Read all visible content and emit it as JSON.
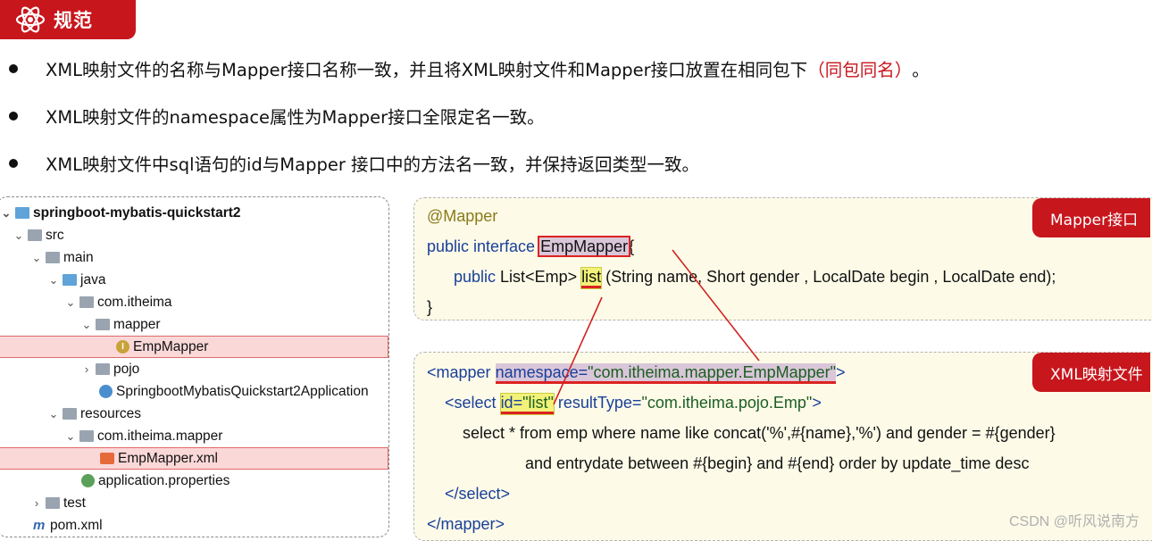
{
  "header": {
    "title": "规范",
    "icon": "atom-icon"
  },
  "bullets": [
    {
      "text": "XML映射文件的名称与Mapper接口名称一致，并且将XML映射文件和Mapper接口放置在相同包下",
      "red": "（同包同名）",
      "tail": "。"
    },
    {
      "text": "XML映射文件的namespace属性为Mapper接口全限定名一致。"
    },
    {
      "text": "XML映射文件中sql语句的id与Mapper 接口中的方法名一致，并保持返回类型一致。"
    }
  ],
  "tree": [
    {
      "label": "springboot-mybatis-quickstart2",
      "icon": "module-folder-icon"
    },
    {
      "label": "src",
      "icon": "folder-icon"
    },
    {
      "label": "main",
      "icon": "folder-icon"
    },
    {
      "label": "java",
      "icon": "source-folder-icon"
    },
    {
      "label": "com.itheima",
      "icon": "package-icon"
    },
    {
      "label": "mapper",
      "icon": "package-icon"
    },
    {
      "label": "EmpMapper",
      "icon": "interface-icon"
    },
    {
      "label": "pojo",
      "icon": "package-icon"
    },
    {
      "label": "SpringbootMybatisQuickstart2Application",
      "icon": "spring-class-icon"
    },
    {
      "label": "resources",
      "icon": "resources-folder-icon"
    },
    {
      "label": "com.itheima.mapper",
      "icon": "folder-icon"
    },
    {
      "label": "EmpMapper.xml",
      "icon": "xml-file-icon"
    },
    {
      "label": "application.properties",
      "icon": "properties-file-icon"
    },
    {
      "label": "test",
      "icon": "folder-icon"
    },
    {
      "label": "pom.xml",
      "icon": "maven-icon"
    }
  ],
  "mapper_code": {
    "tag": "Mapper接口",
    "annotation": "@Mapper",
    "decl_kw": "public interface",
    "iface_name": "EmpMapper",
    "brace_open": "{",
    "method_kw": "public",
    "method_type": "List<Emp>",
    "method_name": "list",
    "method_params": "(String name, Short gender , LocalDate begin , LocalDate end);",
    "brace_close": "}"
  },
  "xml_code": {
    "tag": "XML映射文件",
    "open_mapper": "<mapper",
    "ns_attr": "namespace=",
    "ns_value": "\"com.itheima.mapper.EmpMapper\"",
    "gt": ">",
    "select_open": "<select",
    "id_attr": "id=",
    "id_value": "\"list\"",
    "result_attr": "resultType=",
    "result_value": "\"com.itheima.pojo.Emp\"",
    "sql1": "select * from emp where name like concat('%',#{name},'%') and gender = #{gender}",
    "sql2": "and entrydate between #{begin} and #{end} order by update_time desc",
    "select_close": "</select>",
    "mapper_close": "</mapper>"
  },
  "watermark": "CSDN @听风说南方",
  "colors": {
    "accent": "#c8161d",
    "code_bg": "#fdfbe8",
    "keyword": "#1a3f9a",
    "string": "#1b5e20",
    "connector": "#d22222"
  }
}
